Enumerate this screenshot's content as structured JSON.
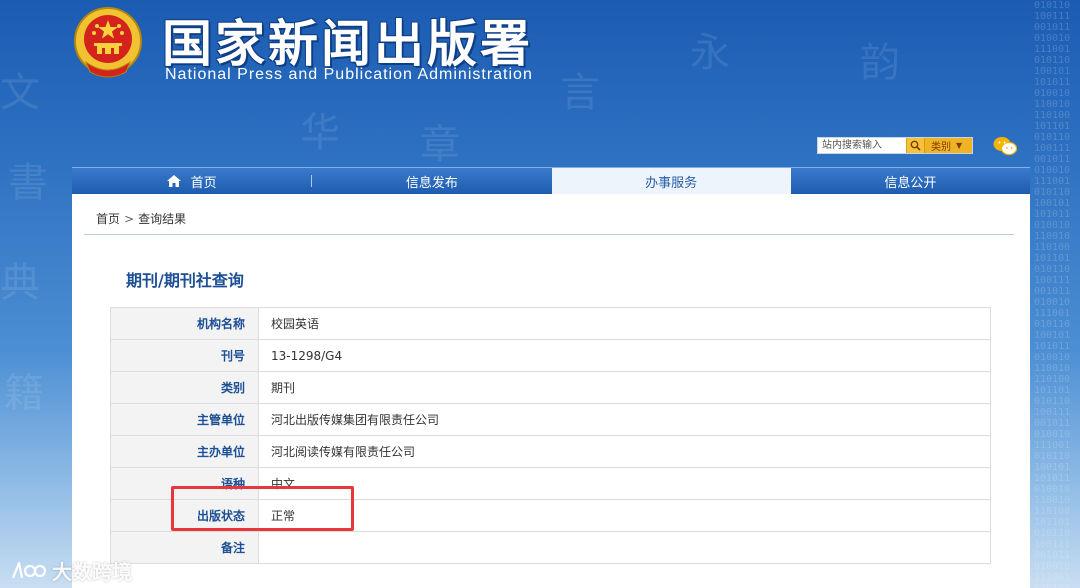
{
  "header": {
    "title_cn": "国家新闻出版署",
    "title_en": "National Press and Publication Administration"
  },
  "search": {
    "placeholder": "站内搜索输入",
    "category_label": "类别"
  },
  "nav": {
    "items": [
      {
        "label": "首页",
        "icon": "home-icon"
      },
      {
        "label": "信息发布"
      },
      {
        "label": "办事服务",
        "active": true
      },
      {
        "label": "信息公开"
      }
    ]
  },
  "breadcrumb": {
    "home": "首页",
    "separator": ">",
    "current": "查询结果"
  },
  "query": {
    "title": "期刊/期刊社查询",
    "rows": [
      {
        "key": "机构名称",
        "value": "校园英语"
      },
      {
        "key": "刊号",
        "value": "13-1298/G4"
      },
      {
        "key": "类别",
        "value": "期刊"
      },
      {
        "key": "主管单位",
        "value": "河北出版传媒集团有限责任公司"
      },
      {
        "key": "主办单位",
        "value": "河北阅读传媒有限责任公司"
      },
      {
        "key": "语种",
        "value": "中文"
      },
      {
        "key": "出版状态",
        "value": "正常"
      },
      {
        "key": "备注",
        "value": ""
      }
    ]
  },
  "watermark": {
    "text": "大数跨境"
  },
  "colors": {
    "primary_blue": "#1d5cae",
    "label_blue": "#1d4f95",
    "highlight_red": "#e8373c",
    "search_orange": "#f0b325"
  }
}
